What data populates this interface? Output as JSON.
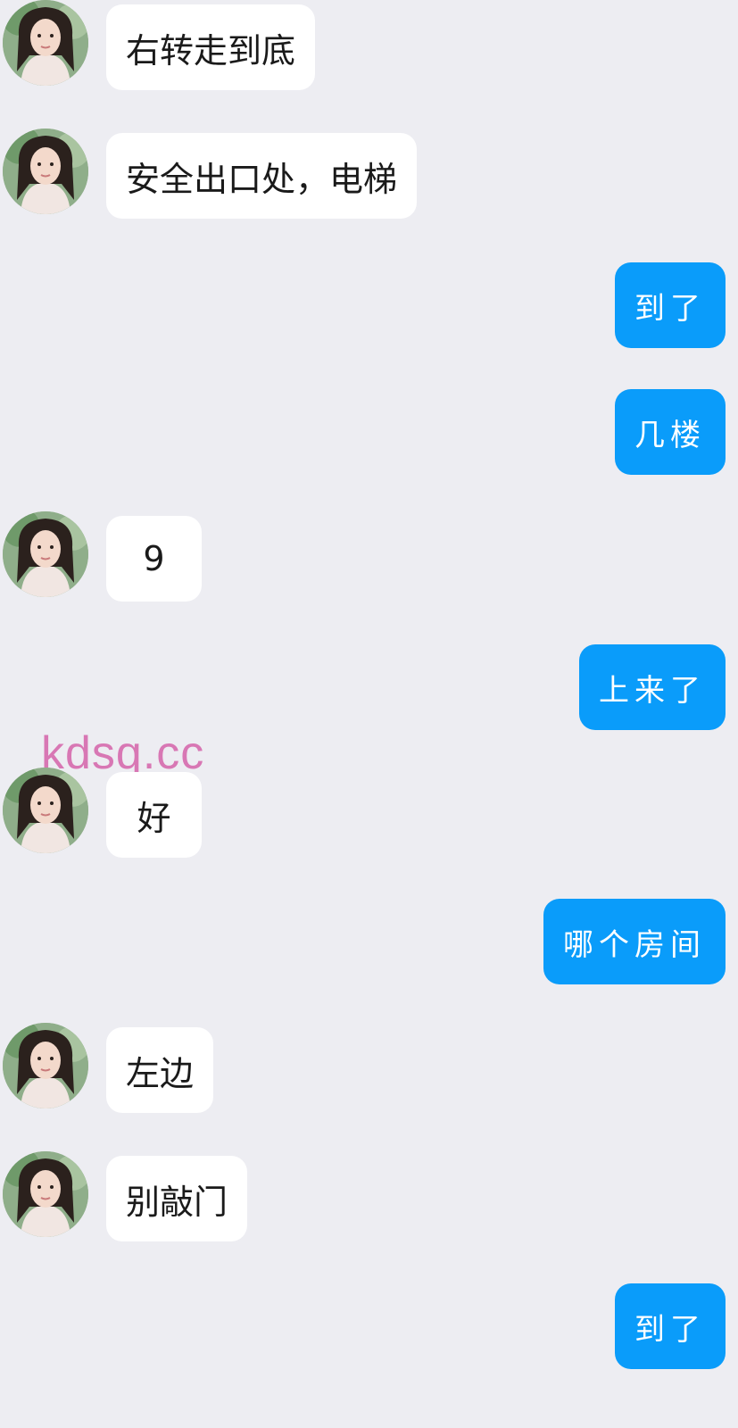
{
  "conversation": {
    "messages": [
      {
        "sender": "contact",
        "text": "右转走到底"
      },
      {
        "sender": "contact",
        "text": "安全出口处，电梯"
      },
      {
        "sender": "me",
        "text": "到了"
      },
      {
        "sender": "me",
        "text": "几楼"
      },
      {
        "sender": "contact",
        "text": "9"
      },
      {
        "sender": "me",
        "text": "上来了"
      },
      {
        "sender": "contact",
        "text": "好"
      },
      {
        "sender": "me",
        "text": "哪个房间"
      },
      {
        "sender": "contact",
        "text": "左边"
      },
      {
        "sender": "contact",
        "text": "别敲门"
      },
      {
        "sender": "me",
        "text": "到了"
      }
    ]
  },
  "watermark": {
    "text": "kdsq.cc",
    "color": "#d877b4"
  },
  "colors": {
    "background": "#ededf2",
    "incoming_bubble": "#ffffff",
    "outgoing_bubble": "#0a9cfa"
  },
  "icons": {
    "avatar": "contact-avatar-photo"
  }
}
